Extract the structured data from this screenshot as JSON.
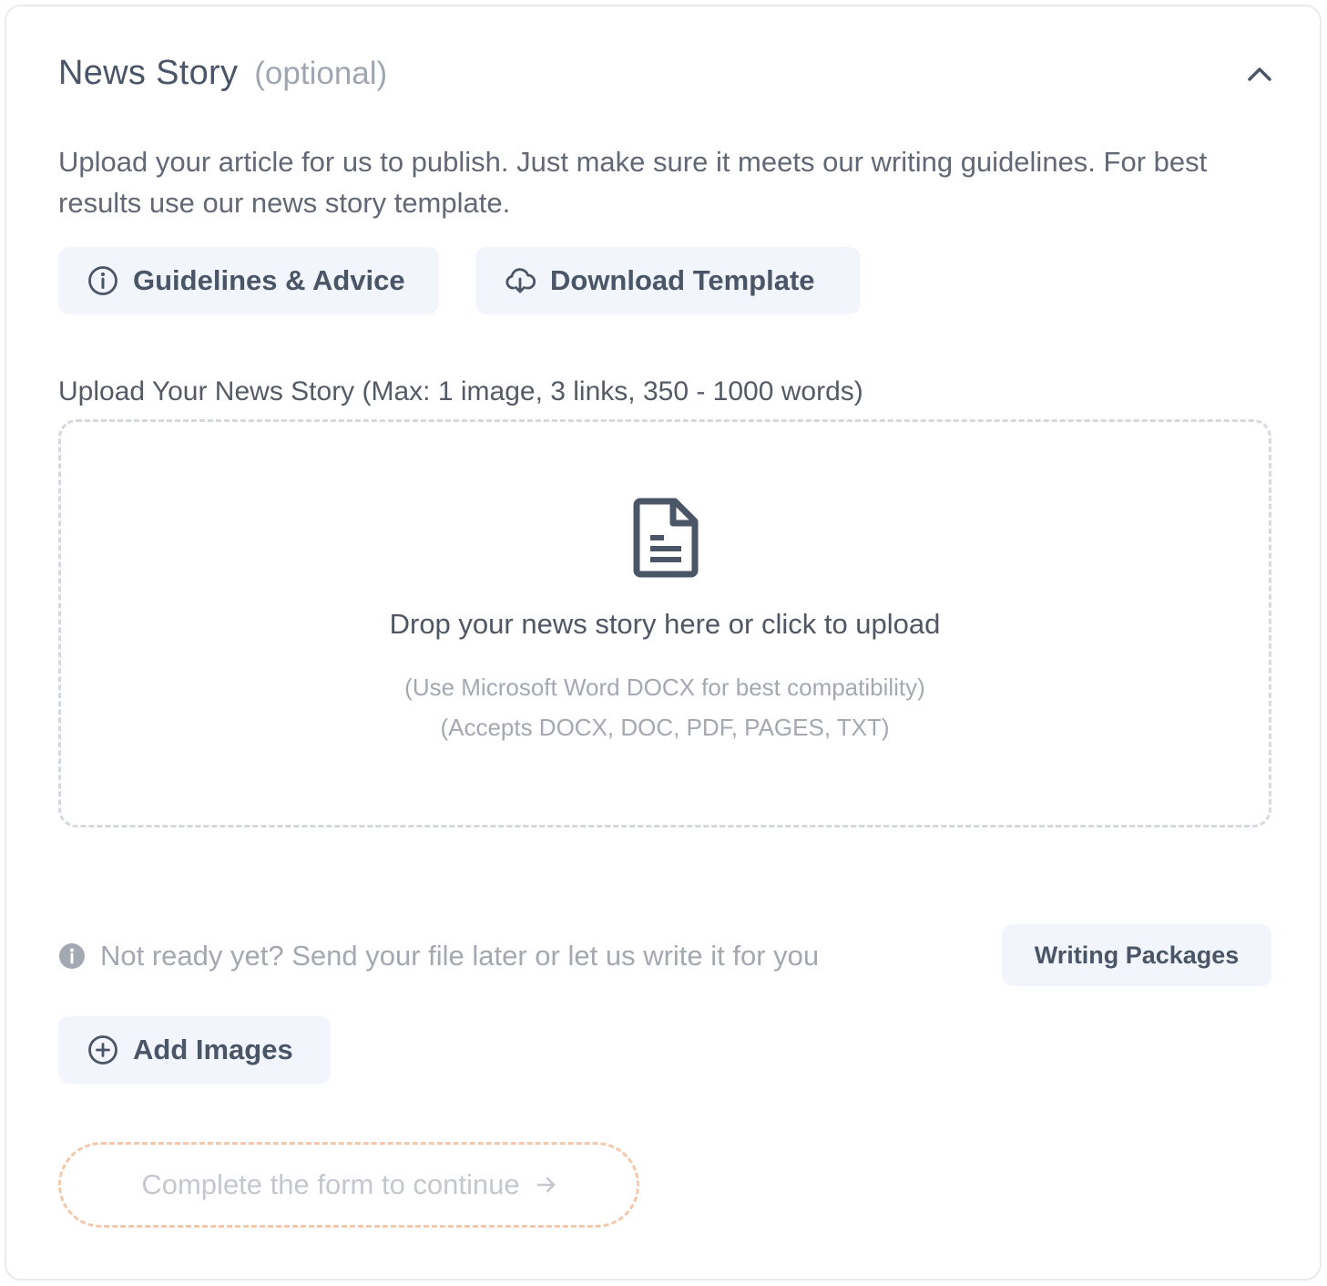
{
  "section": {
    "title": "News Story",
    "optional_label": "(optional)",
    "collapse_icon": "chevron-up-icon",
    "intro": "Upload your article for us to publish. Just make sure it meets our writing guidelines. For best results use our news story template."
  },
  "actions": {
    "guidelines_label": "Guidelines & Advice",
    "guidelines_icon": "info-circle-icon",
    "download_label": "Download Template",
    "download_icon": "cloud-download-icon"
  },
  "upload": {
    "label": "Upload Your News Story (Max: 1 image, 3 links, 350 - 1000 words)",
    "icon": "document-icon",
    "drop_text": "Drop your news story here or click to upload",
    "hint_format": "(Use Microsoft Word DOCX for best compatibility)",
    "hint_accepts": "(Accepts DOCX, DOC, PDF, PAGES, TXT)"
  },
  "notice": {
    "icon": "info-icon",
    "text": "Not ready yet? Send your file later or let us write it for you",
    "writing_packages_label": "Writing Packages"
  },
  "images": {
    "add_label": "Add Images",
    "add_icon": "plus-circle-icon"
  },
  "footer": {
    "continue_label": "Complete the form to continue",
    "continue_icon": "arrow-right-icon"
  },
  "colors": {
    "text_primary": "#4a5568",
    "text_muted": "#a3a8b1",
    "button_bg": "#f2f5fc",
    "dropzone_border": "#d6d9de",
    "continue_border": "#f3c8ab"
  }
}
